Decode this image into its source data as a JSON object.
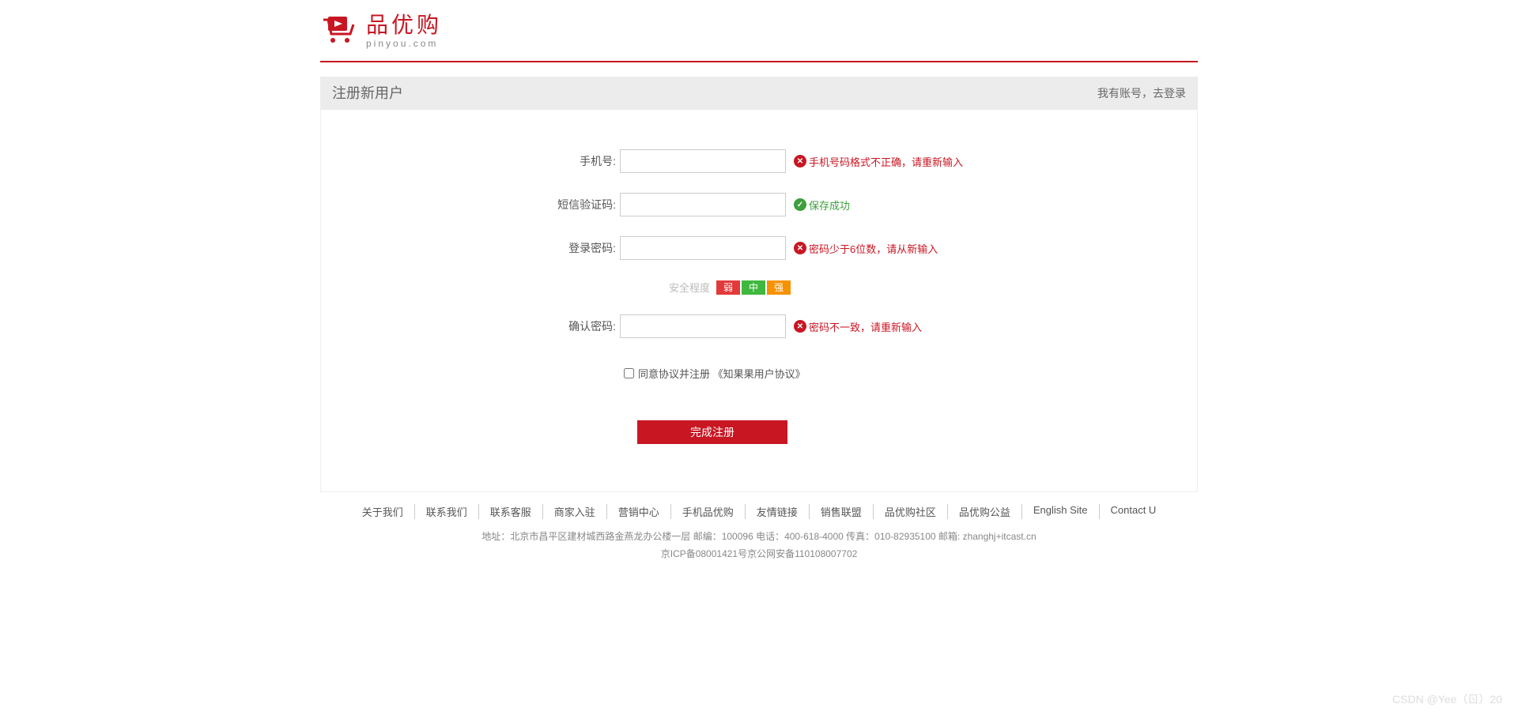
{
  "logo": {
    "cn": "品优购",
    "en": "pinyou.com"
  },
  "titleBar": {
    "title": "注册新用户",
    "loginLink": "我有账号，去登录"
  },
  "form": {
    "phone": {
      "label": "手机号:",
      "value": "",
      "msg": "手机号码格式不正确，请重新输入"
    },
    "sms": {
      "label": "短信验证码:",
      "value": "",
      "msg": "保存成功"
    },
    "password": {
      "label": "登录密码:",
      "value": "",
      "msg": "密码少于6位数，请从新输入"
    },
    "strength": {
      "label": "安全程度",
      "weak": "弱",
      "mid": "中",
      "strong": "强"
    },
    "confirm": {
      "label": "确认密码:",
      "value": "",
      "msg": "密码不一致，请重新输入"
    },
    "agree": {
      "text": "同意协议并注册 ",
      "link": "《知果果用户协议》"
    },
    "submit": "完成注册"
  },
  "footer": {
    "links": [
      "关于我们",
      "联系我们",
      "联系客服",
      "商家入驻",
      "营销中心",
      "手机品优购",
      "友情链接",
      "销售联盟",
      "品优购社区",
      "品优购公益",
      "English Site",
      "Contact U"
    ],
    "address": "地址：北京市昌平区建材城西路金燕龙办公楼一层 邮编：100096 电话：400-618-4000 传真：010-82935100 邮箱: zhanghj+itcast.cn",
    "icp": "京ICP备08001421号京公网安备110108007702"
  },
  "watermark": "CSDN @Yee（ㄖ）20"
}
